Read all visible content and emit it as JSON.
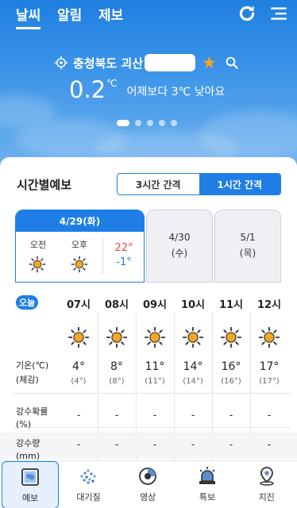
{
  "header": {
    "tabs": [
      {
        "label": "날씨",
        "active": true
      },
      {
        "label": "알림",
        "active": false
      },
      {
        "label": "제보",
        "active": false
      }
    ],
    "icons": [
      "refresh-icon",
      "menu-icon"
    ]
  },
  "location": {
    "name": "충청북도 괴산",
    "favorite": true,
    "icons": [
      "location-target-icon",
      "star-icon",
      "search-icon"
    ]
  },
  "current": {
    "temperature": "0.2",
    "unit": "℃",
    "comparison": "어제보다 3℃ 낮아요"
  },
  "carousel": {
    "pages": 5,
    "active_index": 0
  },
  "forecast": {
    "title": "시간별예보",
    "interval_options": [
      "3시간 간격",
      "1시간 간격"
    ],
    "selected_interval": "1시간 간격",
    "days": [
      {
        "label": "4/29(화)",
        "selected": true,
        "am_label": "오전",
        "pm_label": "오후",
        "am_icon": "sun-icon",
        "pm_icon": "sun-icon",
        "high": "22°",
        "low": "-1°"
      },
      {
        "date": "4/30",
        "weekday": "(수)",
        "selected": false
      },
      {
        "date": "5/1",
        "weekday": "(목)",
        "selected": false
      }
    ],
    "today_badge": "오늘",
    "row_labels": {
      "temp": "기온(℃)",
      "feel": "(체감)",
      "prob_1": "강수확률",
      "prob_2": "(%)",
      "amount_1": "강수량",
      "amount_2": "(mm)"
    },
    "hours": [
      {
        "time": "07시",
        "icon": "sun-icon",
        "temp": "4°",
        "feel": "(4°)",
        "prob": "-",
        "amount": "-"
      },
      {
        "time": "08시",
        "icon": "sun-icon",
        "temp": "8°",
        "feel": "(8°)",
        "prob": "-",
        "amount": "-"
      },
      {
        "time": "09시",
        "icon": "sun-icon",
        "temp": "11°",
        "feel": "(11°)",
        "prob": "-",
        "amount": "-"
      },
      {
        "time": "10시",
        "icon": "sun-icon",
        "temp": "14°",
        "feel": "(14°)",
        "prob": "-",
        "amount": "-"
      },
      {
        "time": "11시",
        "icon": "sun-icon",
        "temp": "16°",
        "feel": "(16°)",
        "prob": "-",
        "amount": "-"
      },
      {
        "time": "12시",
        "icon": "sun-icon",
        "temp": "17°",
        "feel": "(17°)",
        "prob": "-",
        "amount": "-"
      }
    ]
  },
  "bottom_nav": [
    {
      "label": "예보",
      "icon": "forecast-icon",
      "active": true
    },
    {
      "label": "대기질",
      "icon": "air-quality-icon",
      "active": false
    },
    {
      "label": "영상",
      "icon": "video-icon",
      "active": false
    },
    {
      "label": "특보",
      "icon": "warning-siren-icon",
      "active": false
    },
    {
      "label": "지진",
      "icon": "earthquake-pin-icon",
      "active": false
    }
  ],
  "colors": {
    "accent": "#1e7ee6",
    "sky_top": "#1f7fe0",
    "sky_bottom": "#6fb1ee",
    "sun": "#f5a623",
    "high_temp": "#e84a3a",
    "low_temp": "#1e7ee6",
    "star": "#f5a623"
  }
}
